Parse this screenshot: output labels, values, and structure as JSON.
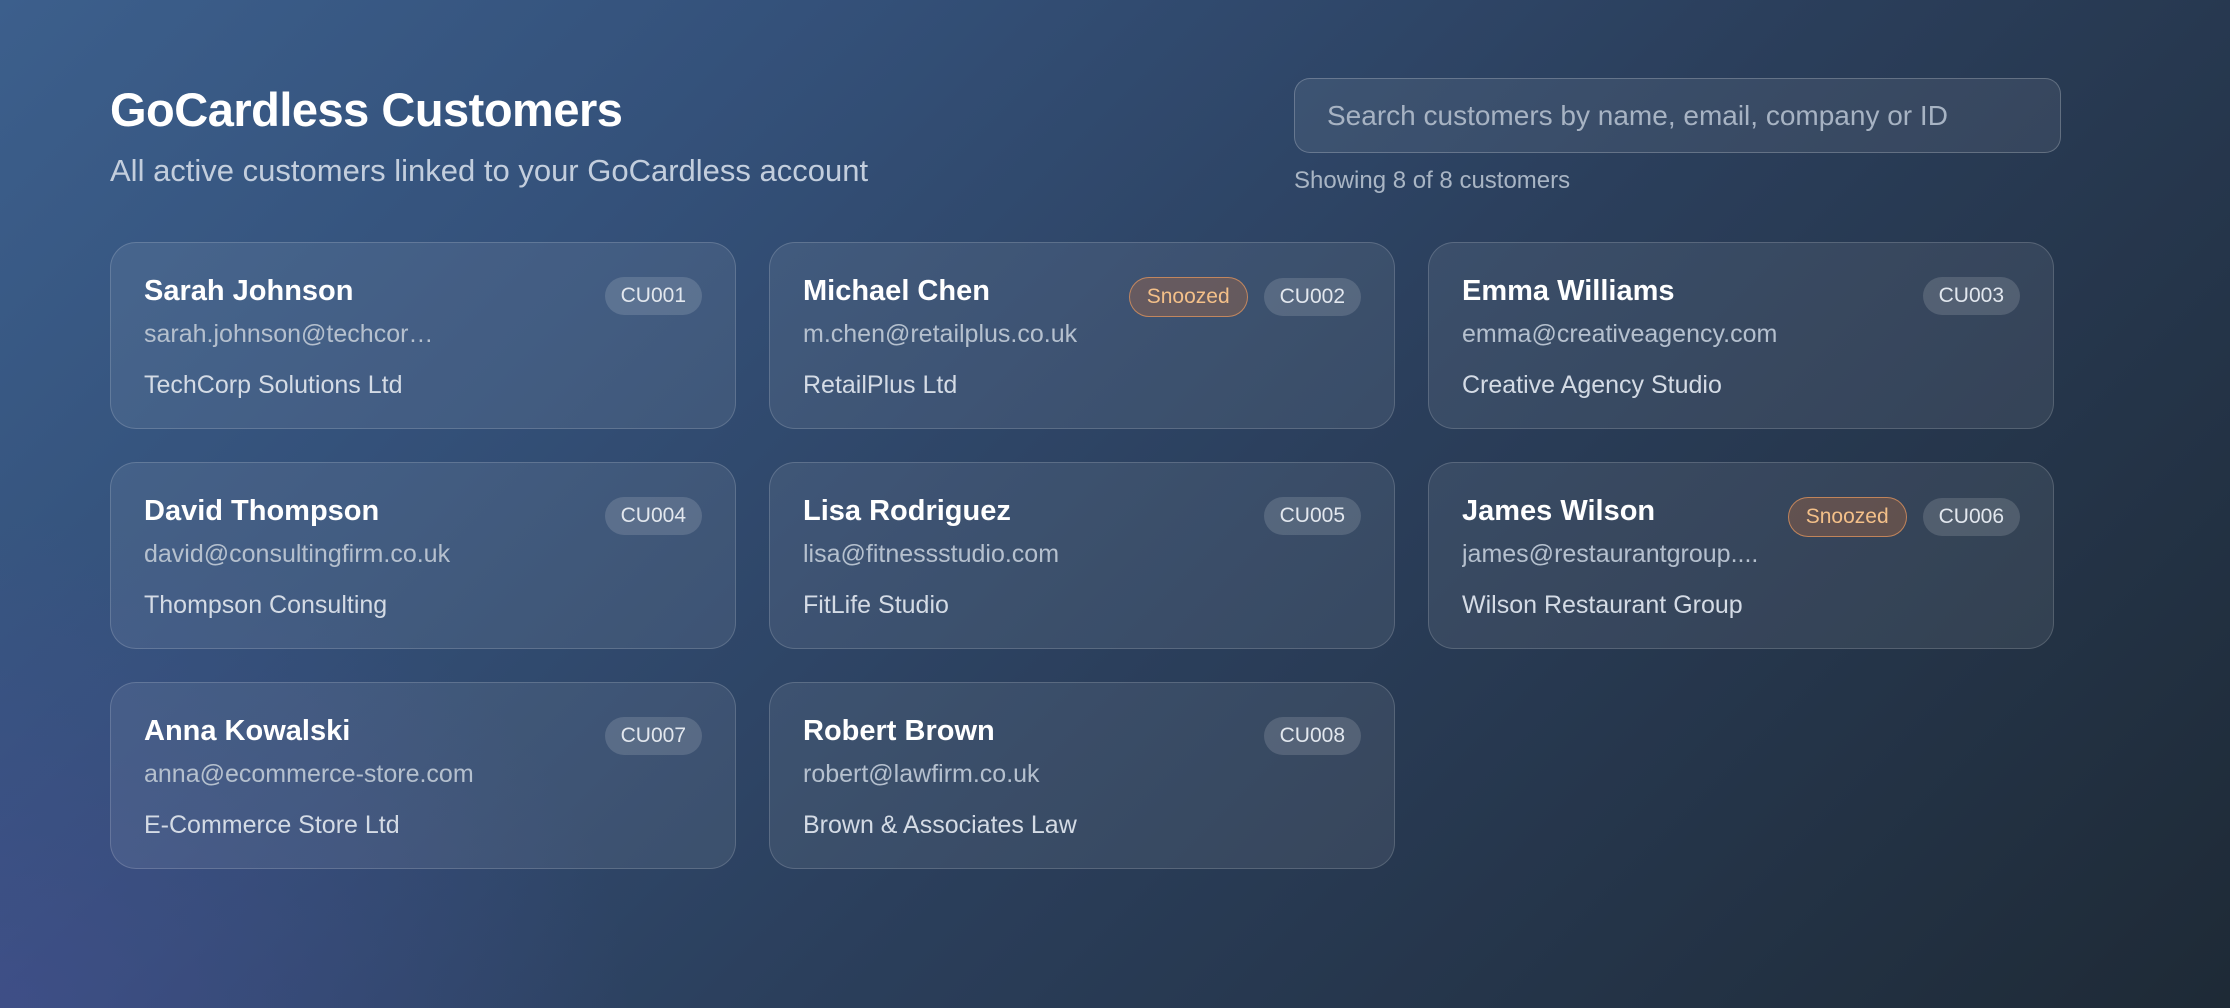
{
  "header": {
    "title": "GoCardless Customers",
    "subtitle": "All active customers linked to your GoCardless account"
  },
  "search": {
    "placeholder": "Search customers by name, email, company or ID",
    "value": "",
    "result_count": "Showing 8 of 8 customers"
  },
  "customers": [
    {
      "name": "Sarah Johnson",
      "email": "sarah.johnson@techcorp.com",
      "company": "TechCorp Solutions Ltd",
      "id": "CU001",
      "status": ""
    },
    {
      "name": "Michael Chen",
      "email": "m.chen@retailplus.co.uk",
      "company": "RetailPlus Ltd",
      "id": "CU002",
      "status": "Snoozed"
    },
    {
      "name": "Emma Williams",
      "email": "emma@creativeagency.com",
      "company": "Creative Agency Studio",
      "id": "CU003",
      "status": ""
    },
    {
      "name": "David Thompson",
      "email": "david@consultingfirm.co.uk",
      "company": "Thompson Consulting",
      "id": "CU004",
      "status": ""
    },
    {
      "name": "Lisa Rodriguez",
      "email": "lisa@fitnessstudio.com",
      "company": "FitLife Studio",
      "id": "CU005",
      "status": ""
    },
    {
      "name": "James Wilson",
      "email": "james@restaurantgroup....",
      "company": "Wilson Restaurant Group",
      "id": "CU006",
      "status": "Snoozed"
    },
    {
      "name": "Anna Kowalski",
      "email": "anna@ecommerce-store.com",
      "company": "E-Commerce Store Ltd",
      "id": "CU007",
      "status": ""
    },
    {
      "name": "Robert Brown",
      "email": "robert@lawfirm.co.uk",
      "company": "Brown & Associates Law",
      "id": "CU008",
      "status": ""
    }
  ]
}
